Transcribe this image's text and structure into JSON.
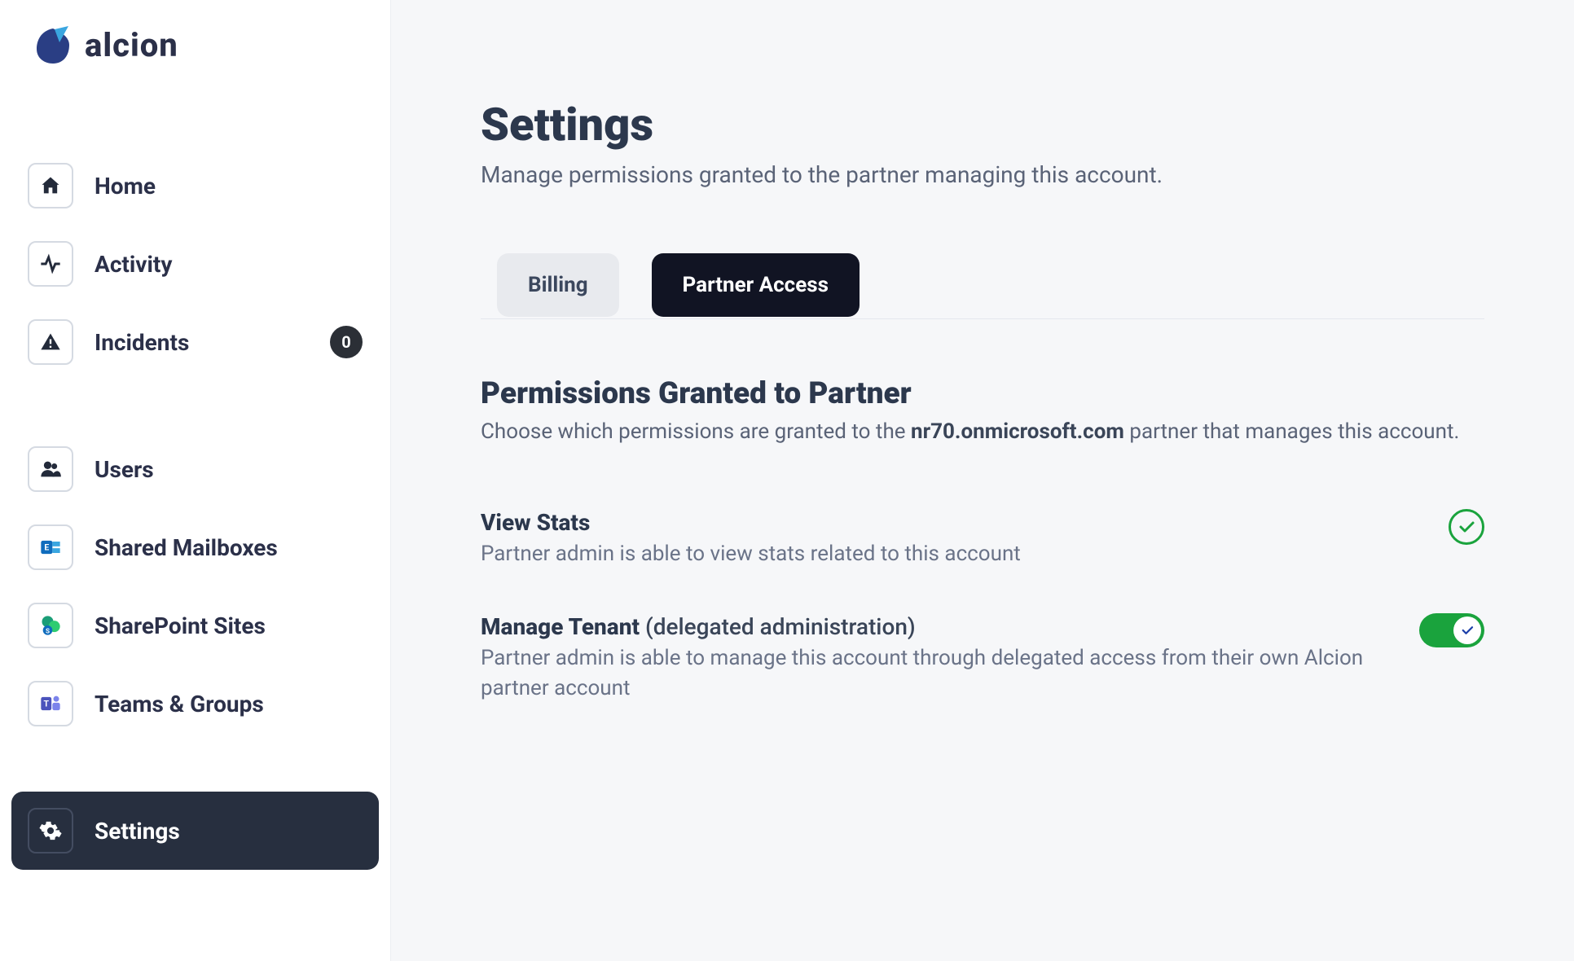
{
  "brand": "alcion",
  "sidebar": {
    "group1": [
      {
        "label": "Home"
      },
      {
        "label": "Activity"
      },
      {
        "label": "Incidents",
        "badge": "0"
      }
    ],
    "group2": [
      {
        "label": "Users"
      },
      {
        "label": "Shared Mailboxes"
      },
      {
        "label": "SharePoint Sites"
      },
      {
        "label": "Teams & Groups"
      }
    ],
    "settings": {
      "label": "Settings"
    }
  },
  "page": {
    "title": "Settings",
    "subtitle": "Manage permissions granted to the partner managing this account."
  },
  "tabs": {
    "billing": "Billing",
    "partner": "Partner Access"
  },
  "section": {
    "title": "Permissions Granted to Partner",
    "desc_pre": "Choose which permissions are granted to the ",
    "desc_bold": "nr70.onmicrosoft.com",
    "desc_post": " partner that manages this account."
  },
  "perms": {
    "view_stats": {
      "title": "View Stats",
      "desc": "Partner admin is able to view stats related to this account"
    },
    "manage_tenant": {
      "title_bold": "Manage Tenant ",
      "title_light": "(delegated administration)",
      "desc": "Partner admin is able to manage this account through delegated access from their own Alcion partner account"
    }
  }
}
